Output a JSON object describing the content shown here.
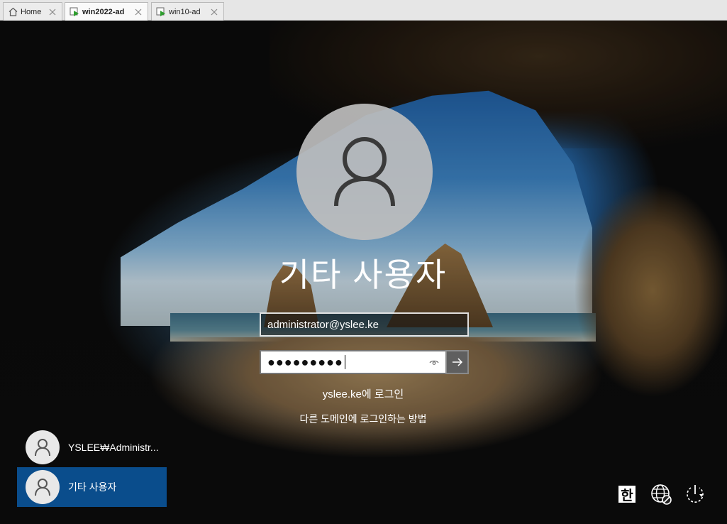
{
  "tabs": [
    {
      "label": "Home",
      "icon": "home-icon",
      "active": false
    },
    {
      "label": "win2022-ad",
      "icon": "vm-running-icon",
      "active": true
    },
    {
      "label": "win10-ad",
      "icon": "vm-running-icon",
      "active": false
    }
  ],
  "login": {
    "title": "기타 사용자",
    "username_value": "administrator@yslee.ke",
    "password_mask": "●●●●●●●●●",
    "domain_text": "yslee.ke에 로그인",
    "other_domain_link": "다른 도메인에 로그인하는 방법"
  },
  "users": [
    {
      "label": "YSLEE₩Administr...",
      "selected": false
    },
    {
      "label": "기타 사용자",
      "selected": true
    }
  ],
  "system_tray": {
    "ime_label": "한",
    "network_icon": "network-globe-icon",
    "power_icon": "power-icon"
  },
  "colors": {
    "selected_user_bg": "#0a4d8c",
    "submit_button_bg": "#5f5f5f"
  }
}
